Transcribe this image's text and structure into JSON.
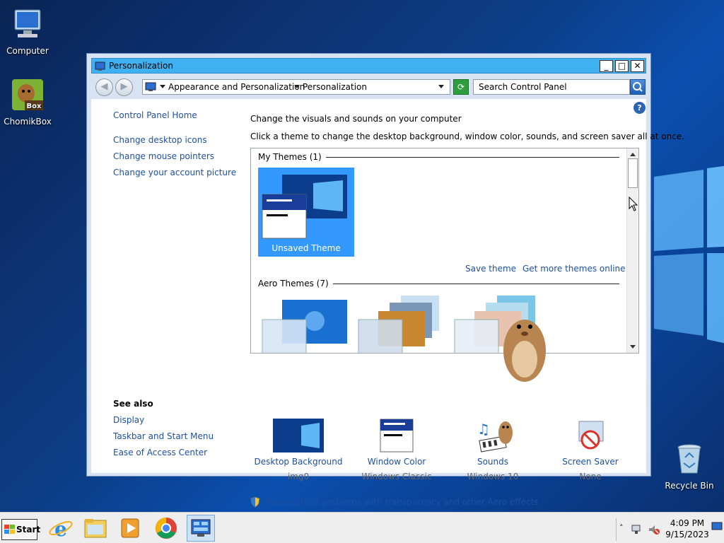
{
  "desktop": {
    "icons": [
      {
        "label": "Computer"
      },
      {
        "label": "ChomikBox"
      },
      {
        "label": "Recycle Bin"
      }
    ]
  },
  "window": {
    "title": "Personalization",
    "controls": {
      "minimize": "_",
      "maximize": "□",
      "close": "✕"
    },
    "address": {
      "crumb1": "Appearance and Personalization",
      "crumb2": "Personalization"
    },
    "search_placeholder": "Search Control Panel"
  },
  "sidebar": {
    "home": "Control Panel Home",
    "links": [
      "Change desktop icons",
      "Change mouse pointers",
      "Change your account picture"
    ],
    "see_also_heading": "See also",
    "see_also": [
      "Display",
      "Taskbar and Start Menu",
      "Ease of Access Center"
    ]
  },
  "main": {
    "heading": "Change the visuals and sounds on your computer",
    "subheading": "Click a theme to change the desktop background, window color, sounds, and screen saver all at once.",
    "my_themes_label": "My Themes (1)",
    "unsaved_theme": "Unsaved Theme",
    "save_theme": "Save theme",
    "get_more": "Get more themes online",
    "aero_themes_label": "Aero Themes (7)",
    "options": [
      {
        "label": "Desktop Background",
        "sub": "img0"
      },
      {
        "label": "Window Color",
        "sub": "Windows Classic"
      },
      {
        "label": "Sounds",
        "sub": "Windows 10"
      },
      {
        "label": "Screen Saver",
        "sub": "None"
      }
    ],
    "troubleshoot": "Troubleshoot problems with transparency and other Aero effects"
  },
  "taskbar": {
    "start": "Start",
    "time": "4:09 PM",
    "date": "9/15/2023"
  },
  "colors": {
    "titlebar": "#3fb1f0",
    "link": "#1e50a2",
    "selected_theme": "#3399ff"
  }
}
